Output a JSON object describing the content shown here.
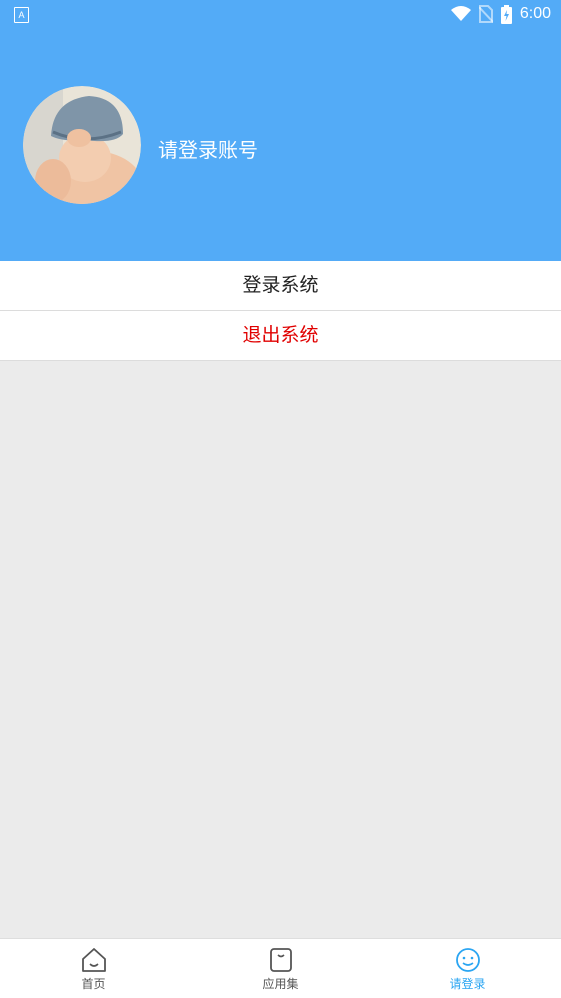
{
  "status_bar": {
    "notification_icon": "A",
    "time": "6:00",
    "icons": [
      "wifi-icon",
      "no-sim-icon",
      "battery-charging-icon"
    ]
  },
  "profile": {
    "avatar": "baby-photo-avatar",
    "username": "请登录账号"
  },
  "menu": {
    "login_label": "登录系统",
    "logout_label": "退出系统"
  },
  "colors": {
    "header": "#53abf7",
    "logout": "#e00000",
    "active_tab": "#2aa5f2",
    "page_background": "#ebebeb"
  },
  "tabs": [
    {
      "label": "首页",
      "icon": "home-icon",
      "active": false
    },
    {
      "label": "应用集",
      "icon": "apps-icon",
      "active": false
    },
    {
      "label": "请登录",
      "icon": "smiley-icon",
      "active": true
    }
  ]
}
